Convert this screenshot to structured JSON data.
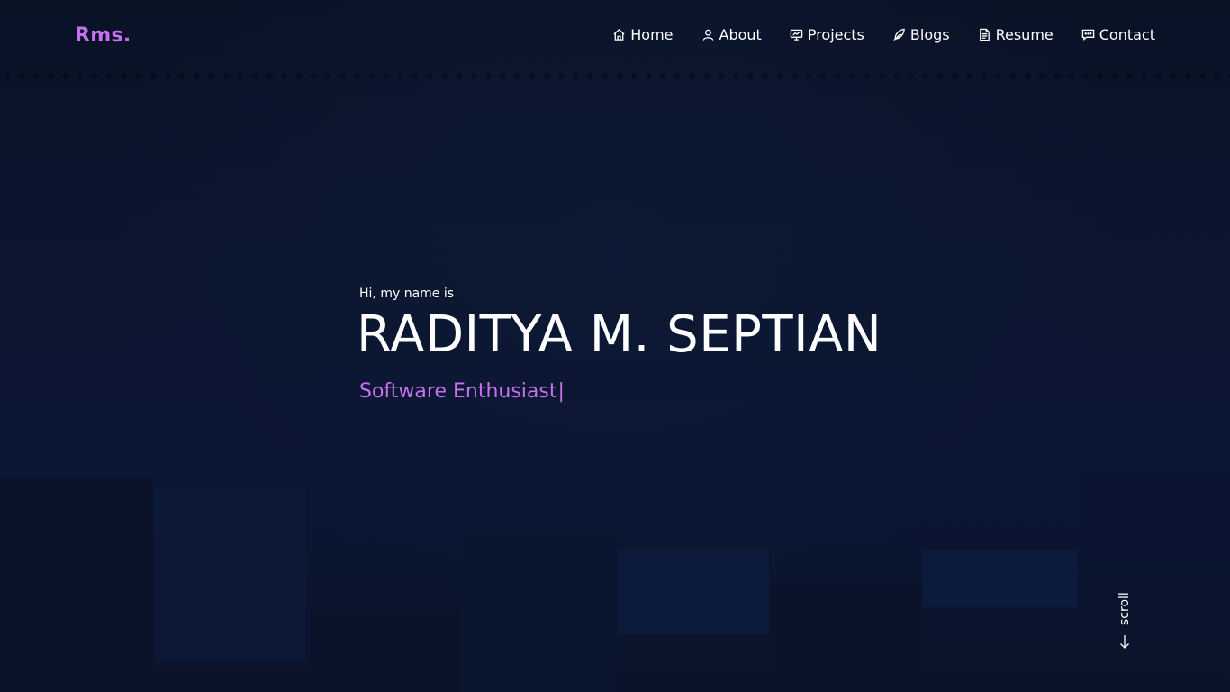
{
  "header": {
    "logo": "Rms.",
    "nav": [
      {
        "label": "Home",
        "icon": "home-icon"
      },
      {
        "label": "About",
        "icon": "user-icon"
      },
      {
        "label": "Projects",
        "icon": "presentation-icon"
      },
      {
        "label": "Blogs",
        "icon": "feather-icon"
      },
      {
        "label": "Resume",
        "icon": "document-icon"
      },
      {
        "label": "Contact",
        "icon": "chat-icon"
      }
    ]
  },
  "hero": {
    "greeting": "Hi, my name is",
    "name": "RADITYA M. SEPTIAN",
    "role": "Software Enthusiast",
    "cursor": "|"
  },
  "scroll": {
    "label": "scroll"
  },
  "colors": {
    "accent": "#c770f0",
    "background": "#0b1327",
    "text": "#ffffff"
  }
}
